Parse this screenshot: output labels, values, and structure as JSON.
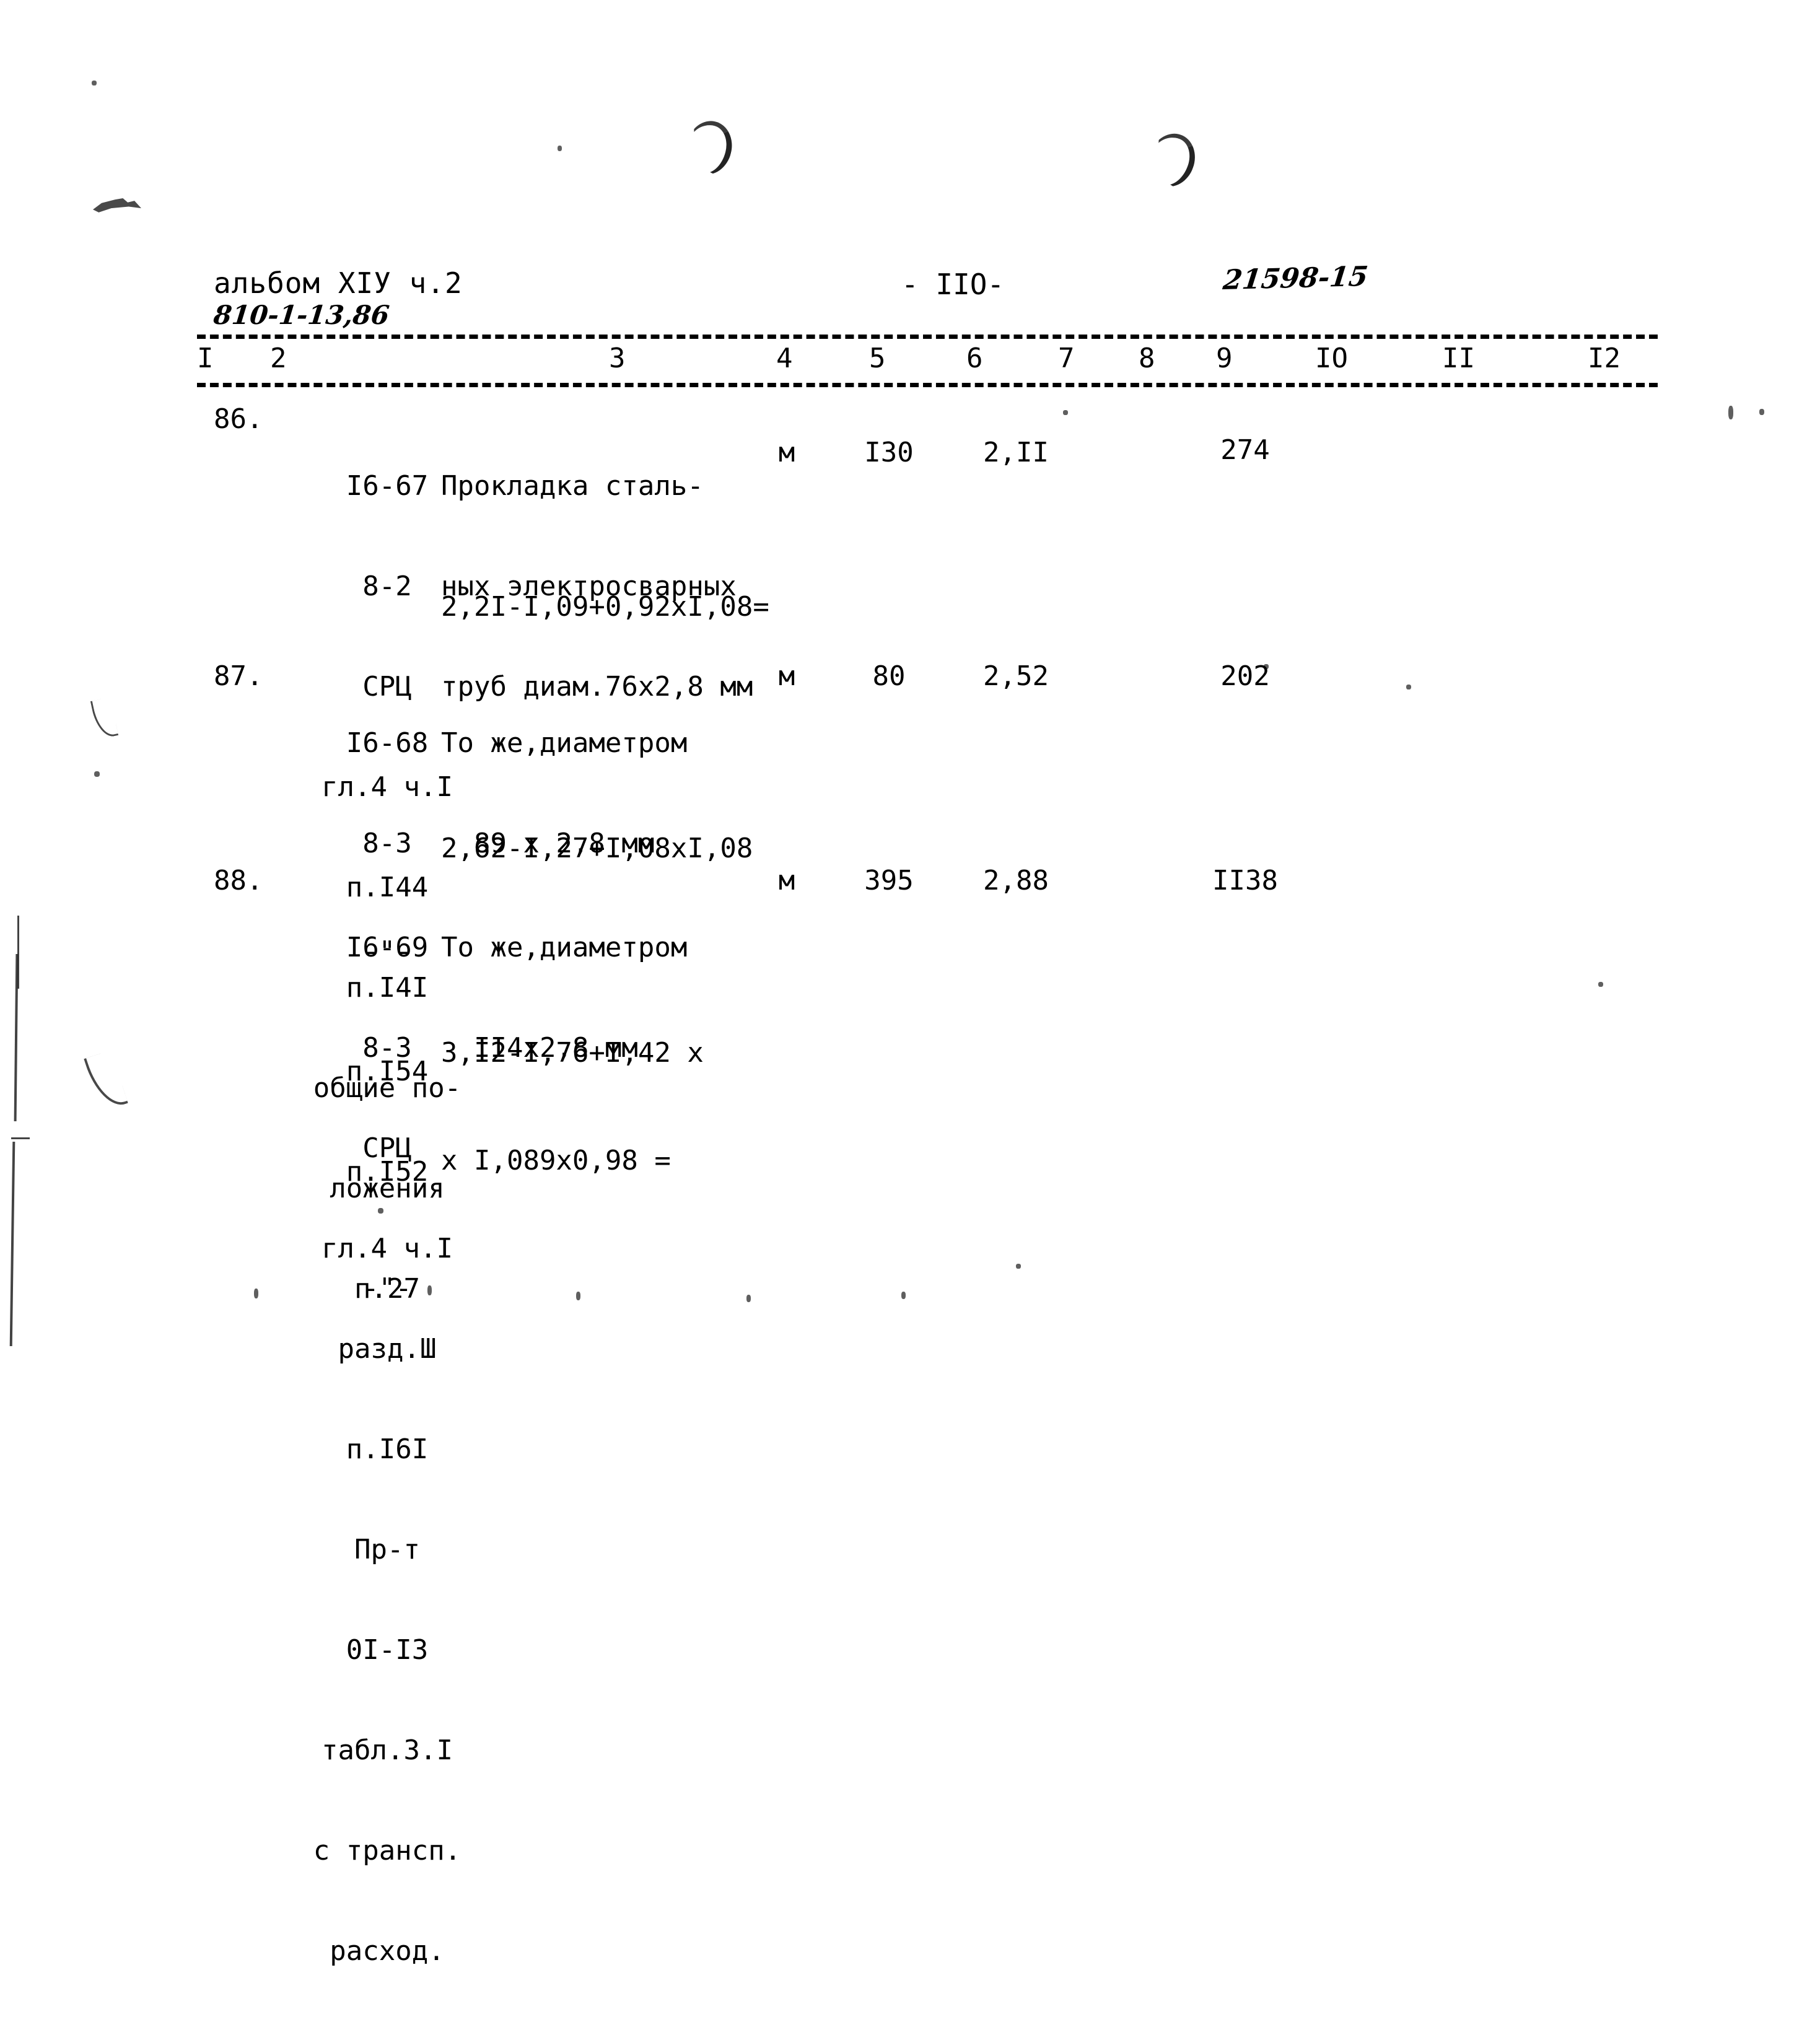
{
  "header": {
    "album_title": "альбом ХIУ ч.2",
    "album_code": "810-1-13,86",
    "page_number": "- IIO-",
    "doc_code": "21598-15"
  },
  "table": {
    "column_numbers": [
      "I",
      "2",
      "3",
      "4",
      "5",
      "6",
      "7",
      "8",
      "9",
      "IO",
      "II",
      "I2"
    ],
    "rows": [
      {
        "no": "86.",
        "code_lines": [
          "I6-67",
          "8-2",
          "СРЦ",
          "гл.4 ч.I",
          "п.I44",
          "п.I4I",
          "общие по-",
          "ложения",
          "п.27"
        ],
        "description_lines": [
          "Прокладка сталь-",
          "ных электросварных",
          "труб диам.76х2,8 мм"
        ],
        "formula_lines": [
          "2,2I-I,09+0,92хI,08="
        ],
        "unit": "м",
        "quantity": "I30",
        "unit_price": "2,II",
        "total": "274"
      },
      {
        "no": "87.",
        "code_lines": [
          "I6-68",
          "8-3",
          "-\"-",
          "п.I54",
          "п.I52",
          "-\"-"
        ],
        "description_lines": [
          "То же,диаметром",
          "  89 х 2,8 мм"
        ],
        "formula_lines": [
          "2,62-I,27+I,08хI,08"
        ],
        "unit": "м",
        "quantity": "80",
        "unit_price": "2,52",
        "total": "202"
      },
      {
        "no": "88.",
        "code_lines": [
          "I6-69",
          "8-3",
          "СРЦ",
          "гл.4 ч.I",
          "разд.Ш",
          "п.I6I",
          "Пр-т",
          "0I-I3",
          "табл.3.I",
          "с трансп.",
          "расход."
        ],
        "description_lines": [
          "То же,диаметром",
          "  II4х2,8 мм"
        ],
        "formula_lines": [
          "3,I2-I,76+I,42 х",
          "х I,089х0,98 ="
        ],
        "unit": "м",
        "quantity": "395",
        "unit_price": "2,88",
        "total": "II38"
      }
    ]
  }
}
